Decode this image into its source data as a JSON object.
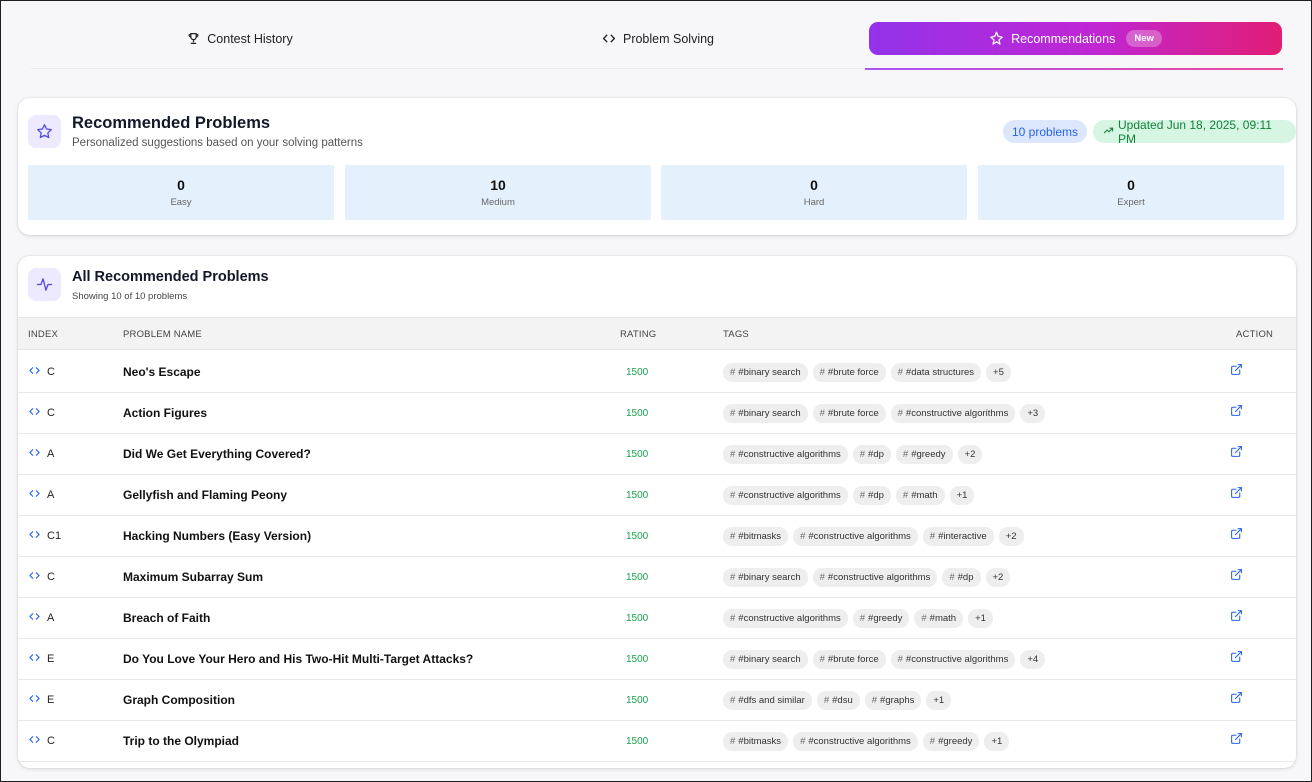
{
  "tabs": [
    {
      "label": "Contest History"
    },
    {
      "label": "Problem Solving"
    },
    {
      "label": "Recommendations",
      "badge": "New"
    }
  ],
  "summary": {
    "title": "Recommended Problems",
    "subtitle": "Personalized suggestions based on your solving patterns",
    "count_pill": "10 problems",
    "updated_pill": "Updated Jun 18, 2025, 09:11 PM",
    "stats": [
      {
        "value": "0",
        "label": "Easy"
      },
      {
        "value": "10",
        "label": "Medium"
      },
      {
        "value": "0",
        "label": "Hard"
      },
      {
        "value": "0",
        "label": "Expert"
      }
    ]
  },
  "table": {
    "title": "All Recommended Problems",
    "subtitle": "Showing 10 of 10 problems",
    "headers": {
      "index": "INDEX",
      "name": "PROBLEM NAME",
      "rating": "RATING",
      "tags": "TAGS",
      "action": "ACTION"
    },
    "rows": [
      {
        "index": "C",
        "name": "Neo's Escape",
        "rating": "1500",
        "tags": [
          "#binary search",
          "#brute force",
          "#data structures"
        ],
        "more": "+5"
      },
      {
        "index": "C",
        "name": "Action Figures",
        "rating": "1500",
        "tags": [
          "#binary search",
          "#brute force",
          "#constructive algorithms"
        ],
        "more": "+3"
      },
      {
        "index": "A",
        "name": "Did We Get Everything Covered?",
        "rating": "1500",
        "tags": [
          "#constructive algorithms",
          "#dp",
          "#greedy"
        ],
        "more": "+2"
      },
      {
        "index": "A",
        "name": "Gellyfish and Flaming Peony",
        "rating": "1500",
        "tags": [
          "#constructive algorithms",
          "#dp",
          "#math"
        ],
        "more": "+1"
      },
      {
        "index": "C1",
        "name": "Hacking Numbers (Easy Version)",
        "rating": "1500",
        "tags": [
          "#bitmasks",
          "#constructive algorithms",
          "#interactive"
        ],
        "more": "+2"
      },
      {
        "index": "C",
        "name": "Maximum Subarray Sum",
        "rating": "1500",
        "tags": [
          "#binary search",
          "#constructive algorithms",
          "#dp"
        ],
        "more": "+2"
      },
      {
        "index": "A",
        "name": "Breach of Faith",
        "rating": "1500",
        "tags": [
          "#constructive algorithms",
          "#greedy",
          "#math"
        ],
        "more": "+1"
      },
      {
        "index": "E",
        "name": "Do You Love Your Hero and His Two-Hit Multi-Target Attacks?",
        "rating": "1500",
        "tags": [
          "#binary search",
          "#brute force",
          "#constructive algorithms"
        ],
        "more": "+4"
      },
      {
        "index": "E",
        "name": "Graph Composition",
        "rating": "1500",
        "tags": [
          "#dfs and similar",
          "#dsu",
          "#graphs"
        ],
        "more": "+1"
      },
      {
        "index": "C",
        "name": "Trip to the Olympiad",
        "rating": "1500",
        "tags": [
          "#bitmasks",
          "#constructive algorithms",
          "#greedy"
        ],
        "more": "+1"
      }
    ]
  }
}
